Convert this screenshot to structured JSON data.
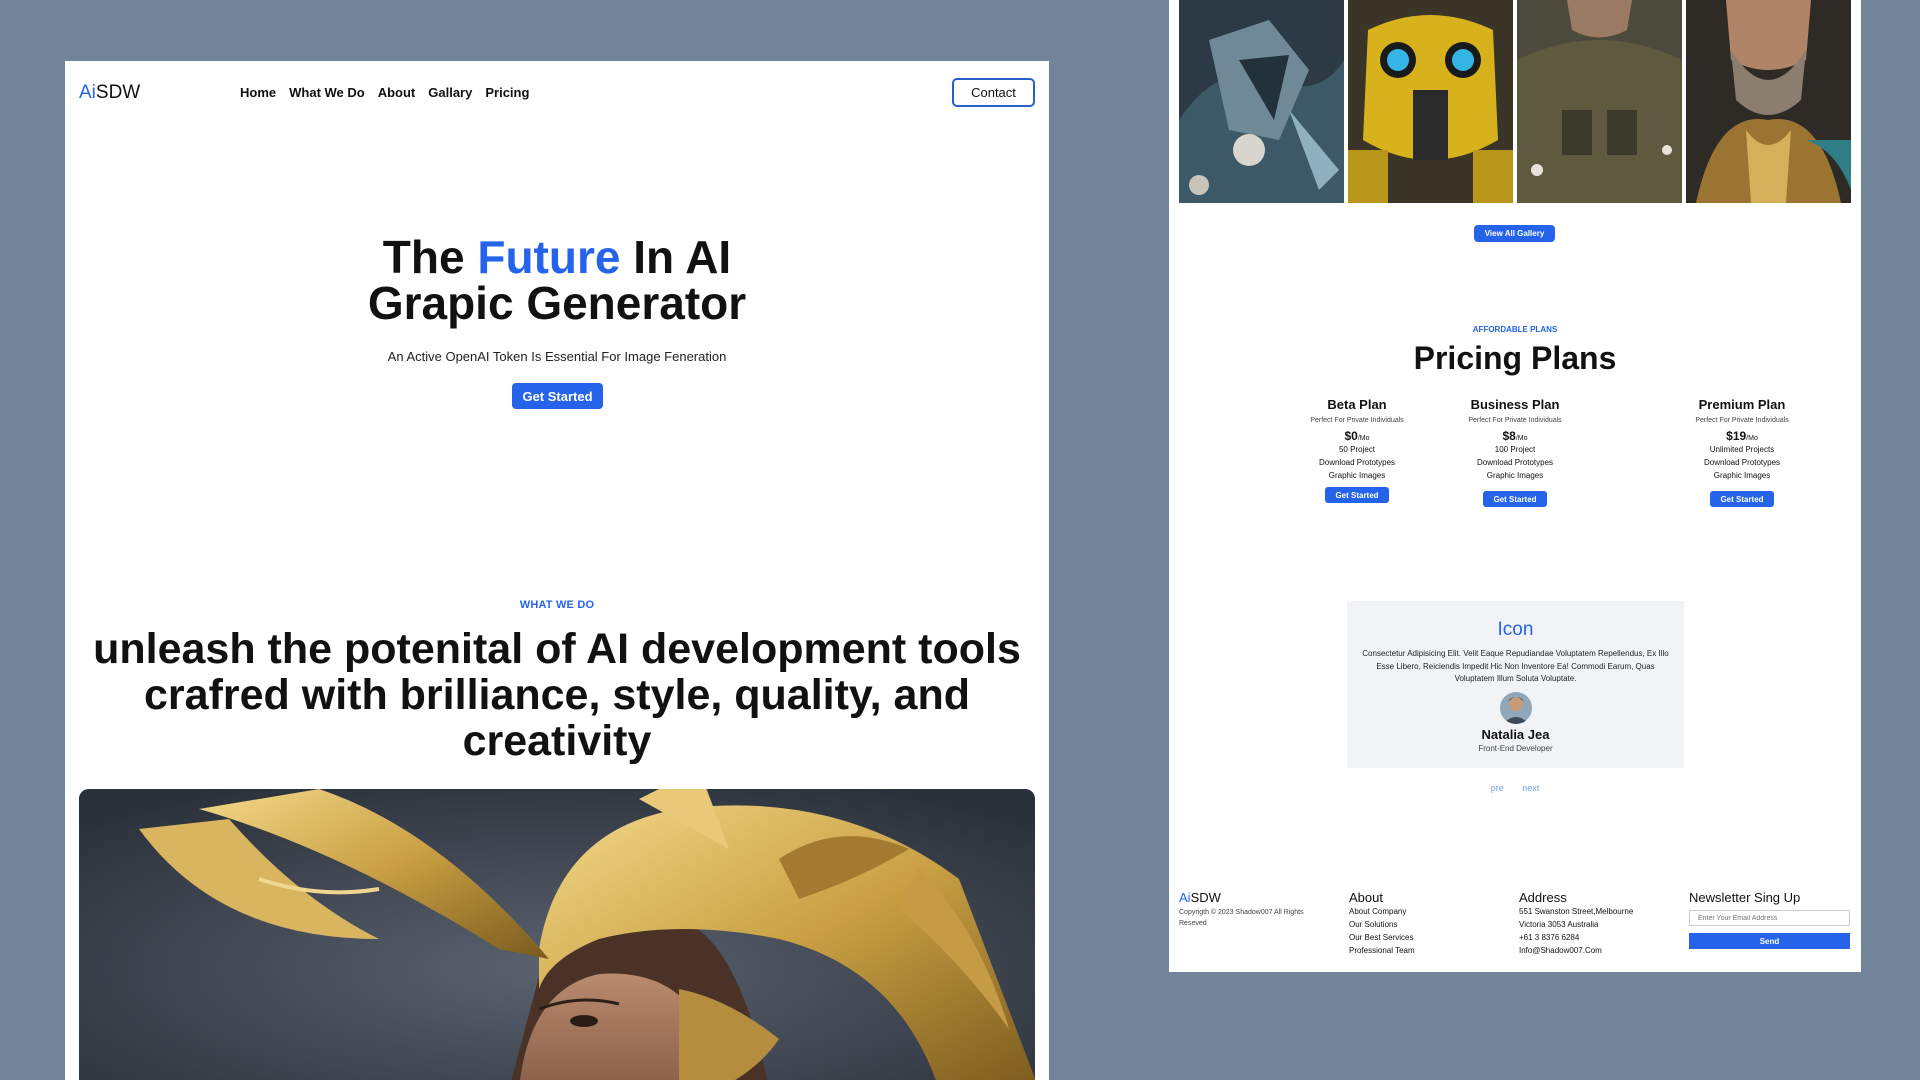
{
  "colors": {
    "background": "#718499",
    "accent": "#2563eb",
    "panel": "#ffffff",
    "testimonial_bg": "#f1f3f7"
  },
  "brand": {
    "ai": "Ai",
    "sdw": "SDW"
  },
  "nav": {
    "links": [
      "Home",
      "What We Do",
      "About",
      "Gallary",
      "Pricing"
    ],
    "contact": "Contact"
  },
  "hero": {
    "title_pre": "The ",
    "title_accent": "Future",
    "title_post": " In AI",
    "title_line2": "Grapic Generator",
    "subtitle": "An Active OpenAI Token Is Essential For Image Feneration",
    "cta": "Get Started"
  },
  "what_we_do": {
    "label": "WHAT WE DO",
    "title": "unleash the potenital of AI development tools crafred with brilliance, style, quality, and creativity"
  },
  "gallery": {
    "view_all": "View All Gallery"
  },
  "pricing": {
    "label": "AFFORDABLE PLANS",
    "title": "Pricing Plans",
    "plans": [
      {
        "name": "Beta Plan",
        "desc": "Perfect For Private Individuals",
        "price": "$0",
        "per": "/Mo",
        "features": [
          "50 Project",
          "Download Prototypes",
          "Graphic Images"
        ],
        "cta": "Get Started"
      },
      {
        "name": "Business Plan",
        "desc": "Perfect For Private Individuals",
        "price": "$8",
        "per": "/Mo",
        "features": [
          "100 Project",
          "Download Prototypes",
          "Graphic Images"
        ],
        "cta": "Get Started"
      },
      {
        "name": "Premium Plan",
        "desc": "Perfect For Private Individuals",
        "price": "$19",
        "per": "/Mo",
        "features": [
          "Unlimited Projects",
          "Download Prototypes",
          "Graphic Images"
        ],
        "cta": "Get Started"
      }
    ]
  },
  "testimonial": {
    "title": "Icon",
    "text": "Consectetur Adipisicing Elit. Velit Eaque Repudiandae Voluptatem Repellendus, Ex Illo Esse Libero, Reiciendis Impedit Hic Non Inventore Ea! Commodi Earum, Quas Voluptatem Illum Soluta Voluptate.",
    "name": "Natalia Jea",
    "role": "Front-End Developer",
    "prev": "pre",
    "next": "next"
  },
  "footer": {
    "copyright": "Copyrigth © 2023 Shadow007 All Rights Reseved",
    "about_heading": "About",
    "about_links": [
      "About Company",
      "Our Solutions",
      "Our Best Services",
      "Professional Team"
    ],
    "address_heading": "Address",
    "address_lines": [
      "551 Swanston Street,Melbourne",
      "Victoria 3053 Australia",
      "+61 3 8376 6284",
      "Info@Shadow007.Com"
    ],
    "newsletter_heading": "Newsletter Sing Up",
    "email_placeholder": "Enter Your Email Address",
    "send": "Send"
  }
}
